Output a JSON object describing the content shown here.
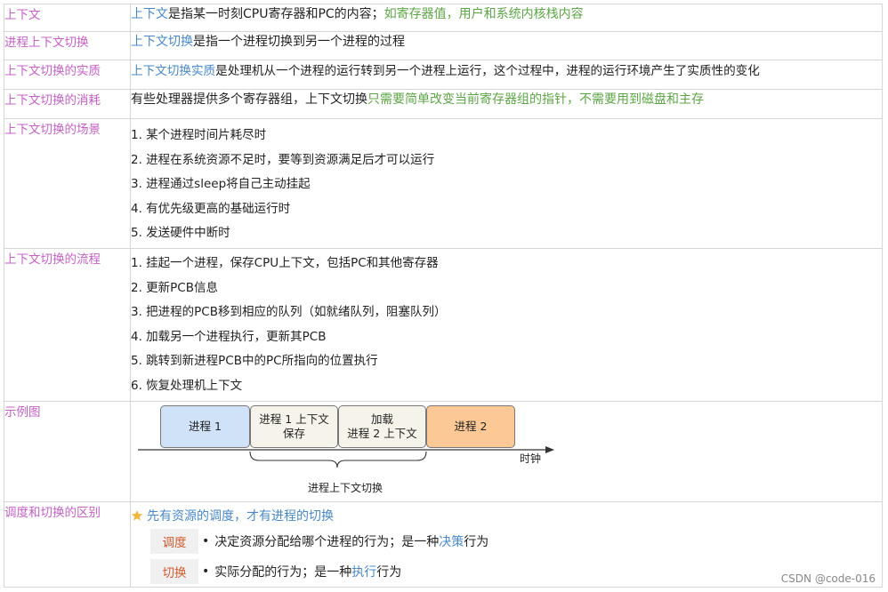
{
  "rows": {
    "context": {
      "label": "上下文",
      "term": "上下文",
      "text": "是指某一时刻CPU寄存器和PC的内容；",
      "note": "如寄存器值，用户和系统内核栈内容"
    },
    "switch": {
      "label": "进程上下文切换",
      "term": "上下文切换",
      "text": "是指一个进程切换到另一个进程的过程"
    },
    "essence": {
      "label": "上下文切换的实质",
      "term": "上下文切换实质",
      "text": "是处理机从一个进程的运行转到另一个进程上运行，这个过程中，进程的运行环境产生了实质性的变化"
    },
    "cost": {
      "label": "上下文切换的消耗",
      "text": "有些处理器提供多个寄存器组，上下文切换",
      "note": "只需要简单改变当前寄存器组的指针，不需要用到磁盘和主存"
    },
    "scenarios": {
      "label": "上下文切换的场景",
      "items": [
        "1. 某个进程时间片耗尽时",
        "2. 进程在系统资源不足时，要等到资源满足后才可以运行",
        "3. 进程通过sleep将自己主动挂起",
        "4. 有优先级更高的基础运行时",
        "5. 发送硬件中断时"
      ]
    },
    "flow": {
      "label": "上下文切换的流程",
      "items": [
        "1. 挂起一个进程，保存CPU上下文，包括PC和其他寄存器",
        "2. 更新PCB信息",
        "3. 把进程的PCB移到相应的队列（如就绪队列，阻塞队列）",
        "4. 加载另一个进程执行，更新其PCB",
        "5. 跳转到新进程PCB中的PC所指向的位置执行",
        "6. 恢复处理机上下文"
      ]
    },
    "example": {
      "label": "示例图",
      "boxes": [
        "进程 1",
        "进程 1 上下文",
        "保存",
        "加载",
        "进程 2 上下文",
        "进程 2"
      ],
      "axis_label": "时钟",
      "brace_label": "进程上下文切换"
    },
    "difference": {
      "label": "调度和切换的区别",
      "star_icon": "star-icon",
      "headline": "先有资源的调度，才有进程的切换",
      "scheduling": {
        "key": "调度",
        "text_a": "决定资源分配给哪个进程的行为；是一种",
        "highlight": "决策",
        "text_b": "行为"
      },
      "switching": {
        "key": "切换",
        "text_a": "实际分配的行为；是一种",
        "highlight": "执行",
        "text_b": "行为"
      }
    }
  },
  "watermark": "CSDN @code-016",
  "colors": {
    "label": "#c560c5",
    "term": "#4a88c7",
    "note": "#5da546",
    "process1_box": "#cfe2f8",
    "context_box": "#f6f3ea",
    "process2_box": "#fcc996",
    "key": "#d15a2a",
    "star": "#f2b53c"
  }
}
